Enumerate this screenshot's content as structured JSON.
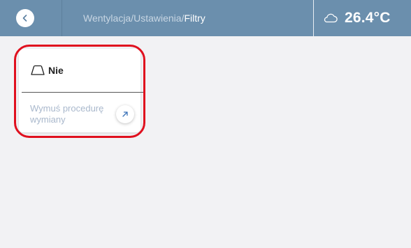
{
  "header": {
    "breadcrumb_parent": "Wentylacja/Ustawienia/",
    "breadcrumb_current": "Filtry",
    "weather_icon": "cloud-icon",
    "temperature": "26.4°C",
    "back_icon": "chevron-left-icon"
  },
  "filter_card": {
    "status_icon": "filter-shape-icon",
    "status": "Nie",
    "action_label": "Wymuś procedurę wymiany",
    "action_icon": "arrow-up-right-icon"
  },
  "colors": {
    "header_bg": "#6b8fad",
    "accent": "#3a72b8",
    "highlight": "#e0101e"
  }
}
